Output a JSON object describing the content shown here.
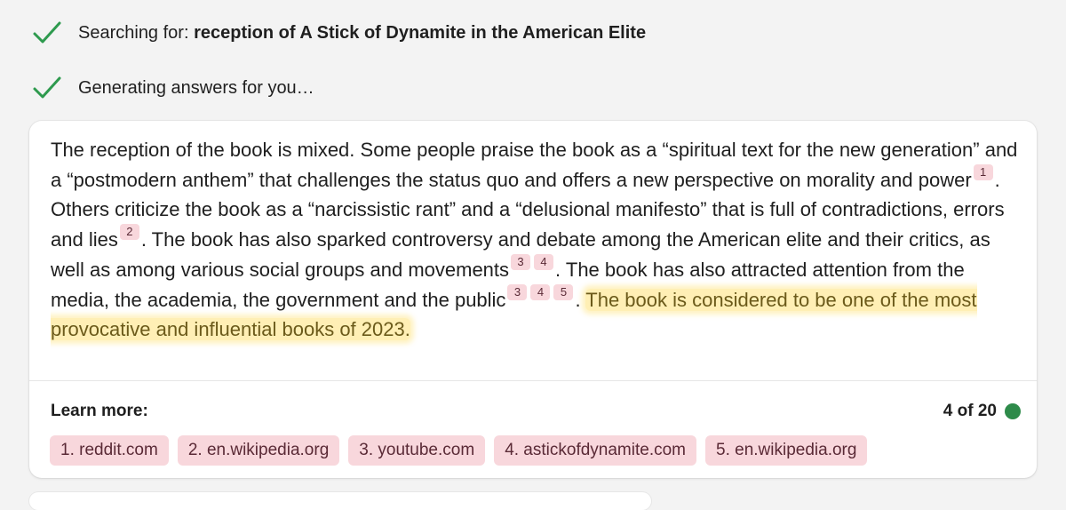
{
  "status": {
    "searching_prefix": "Searching for: ",
    "searching_query": "reception of A Stick of Dynamite in the American Elite",
    "generating": "Generating answers for you…"
  },
  "answer": {
    "p1": "The reception of the book is mixed. Some people praise the book as a “spiritual text for the new generation” and a “postmodern anthem” that challenges the status quo and offers a new perspective on morality and power",
    "p2": ". Others criticize the book as a “narcissistic rant” and a “delusional manifesto” that is full of contradictions, errors and lies",
    "p3": ". The book has also sparked controversy and debate among the American elite and their critics, as well as among various social groups and movements",
    "p4": ". The book has also attracted attention from the media, the academia, the government and the public",
    "p5": ". ",
    "highlight": "The book is considered to be one of the most provocative and influential books of 2023.",
    "citations": [
      "1",
      "2",
      "3",
      "4",
      "3",
      "4",
      "5"
    ]
  },
  "learn_more": {
    "label": "Learn more:",
    "counter": "4 of 20",
    "links": [
      "1. reddit.com",
      "2. en.wikipedia.org",
      "3. youtube.com",
      "4. astickofdynamite.com",
      "5. en.wikipedia.org"
    ]
  },
  "colors": {
    "check": "#2e9a4e",
    "citation_bg": "#f8d7dc",
    "highlight": "#ffe278",
    "status_dot": "#2e8b4a"
  },
  "icons": {
    "status_check": "checkmark-icon",
    "counter_dot": "status-dot-icon"
  }
}
